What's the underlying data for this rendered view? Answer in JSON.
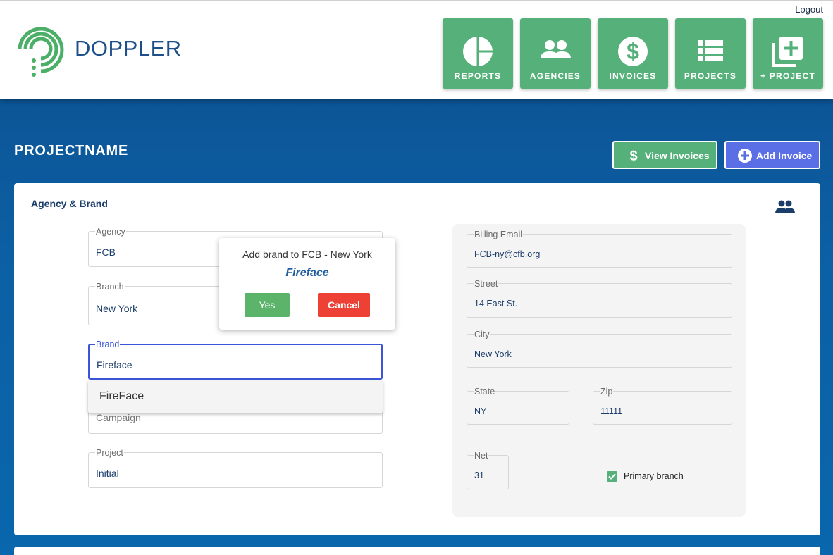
{
  "header": {
    "logo_text": "DOPPLER",
    "logout_label": "Logout",
    "nav": [
      {
        "label": "REPORTS",
        "icon": "pie-chart-icon"
      },
      {
        "label": "AGENCIES",
        "icon": "people-icon"
      },
      {
        "label": "INVOICES",
        "icon": "dollar-circle-icon"
      },
      {
        "label": "PROJECTS",
        "icon": "list-icon"
      },
      {
        "label": "+ PROJECT",
        "icon": "add-box-icon"
      }
    ]
  },
  "page": {
    "title": "PROJECTNAME",
    "view_invoices_label": "View Invoices",
    "add_invoice_label": "Add Invoice"
  },
  "section": {
    "title": "Agency & Brand",
    "left_fields": {
      "agency": {
        "label": "Agency",
        "value": "FCB"
      },
      "branch": {
        "label": "Branch",
        "value": "New York"
      },
      "brand": {
        "label": "Brand",
        "value": "Fireface"
      },
      "campaign": {
        "label": "Campaign",
        "value": ""
      },
      "project": {
        "label": "Project",
        "value": "Initial"
      }
    },
    "campaign_placeholder": "Campaign",
    "right_fields": {
      "billing_email": {
        "label": "Billing Email",
        "value": "FCB-ny@cfb.org"
      },
      "street": {
        "label": "Street",
        "value": "14 East St."
      },
      "city": {
        "label": "City",
        "value": "New York"
      },
      "state": {
        "label": "State",
        "value": "NY"
      },
      "zip": {
        "label": "Zip",
        "value": "11111"
      },
      "net": {
        "label": "Net",
        "value": "31"
      }
    },
    "primary_branch_label": "Primary branch",
    "primary_branch_checked": true
  },
  "dropdown": {
    "options": [
      "FireFace"
    ]
  },
  "popup": {
    "message": "Add brand to FCB - New York",
    "brand": "Fireface",
    "yes_label": "Yes",
    "cancel_label": "Cancel"
  },
  "colors": {
    "nav_green": "#56b07a",
    "add_invoice_blue": "#5a6fe6",
    "cancel_red": "#ec4134",
    "background_blue": "#0c5fa3"
  }
}
